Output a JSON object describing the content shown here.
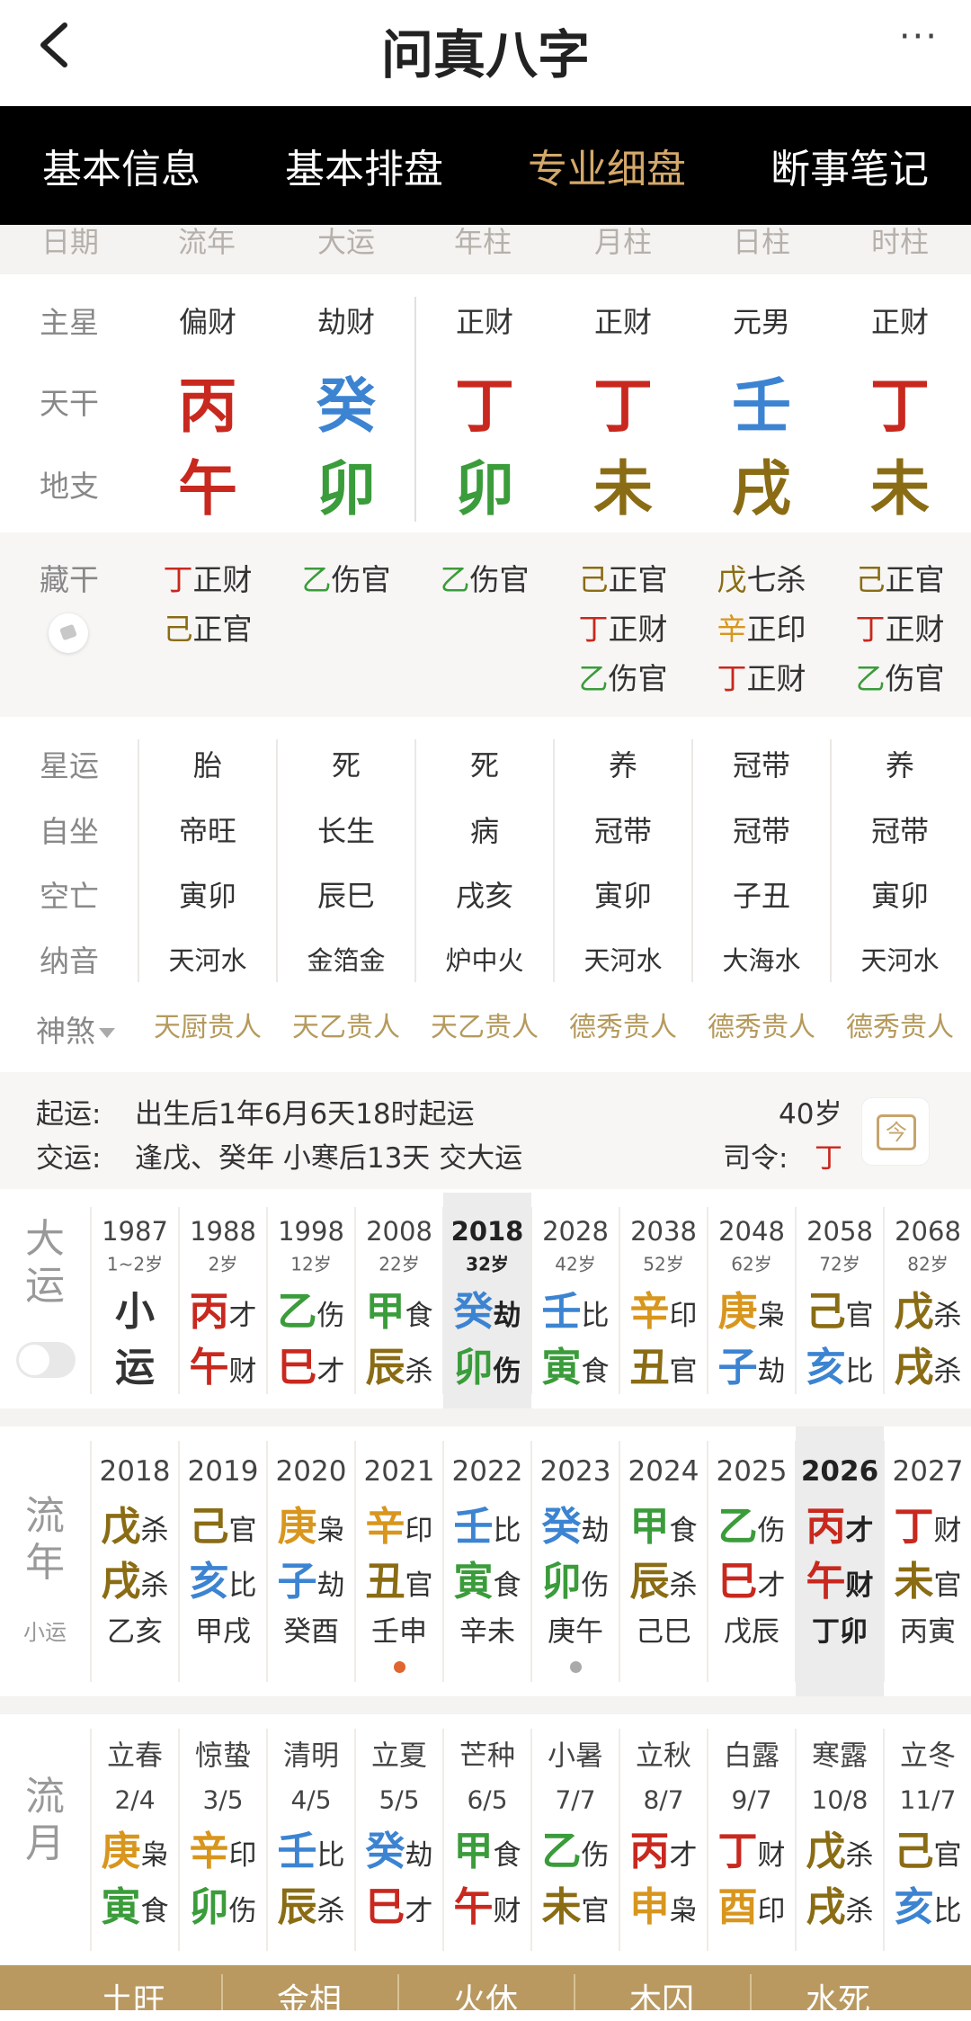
{
  "header": {
    "title": "问真八字",
    "more": "···"
  },
  "tabs": [
    {
      "label": "基本信息",
      "active": false
    },
    {
      "label": "基本排盘",
      "active": false
    },
    {
      "label": "专业细盘",
      "active": true
    },
    {
      "label": "断事笔记",
      "active": false
    }
  ],
  "colors": {
    "red": "#c8281e",
    "blue": "#3c84d2",
    "green": "#3a9c3a",
    "olive": "#8a6c14",
    "orange": "#d8961e",
    "accent": "#d4a86a"
  },
  "ghost_header": [
    "日期",
    "流年",
    "大运",
    "年柱",
    "月柱",
    "日柱",
    "时柱"
  ],
  "pillars": {
    "labels": {
      "star": "主星",
      "tiangan": "天干",
      "dizhi": "地支"
    },
    "columns": [
      {
        "star": "偏财",
        "gan": "丙",
        "gan_color": "red",
        "zhi": "午",
        "zhi_color": "red"
      },
      {
        "star": "劫财",
        "gan": "癸",
        "gan_color": "blue",
        "zhi": "卯",
        "zhi_color": "green"
      },
      {
        "star": "正财",
        "gan": "丁",
        "gan_color": "red",
        "zhi": "卯",
        "zhi_color": "green"
      },
      {
        "star": "正财",
        "gan": "丁",
        "gan_color": "red",
        "zhi": "未",
        "zhi_color": "olive"
      },
      {
        "star": "元男",
        "gan": "壬",
        "gan_color": "blue",
        "zhi": "戌",
        "zhi_color": "olive"
      },
      {
        "star": "正财",
        "gan": "丁",
        "gan_color": "red",
        "zhi": "未",
        "zhi_color": "olive"
      }
    ]
  },
  "canggan": {
    "label": "藏干",
    "columns": [
      [
        {
          "c": "丁",
          "t": "正财",
          "color": "red"
        },
        {
          "c": "己",
          "t": "正官",
          "color": "olive"
        }
      ],
      [
        {
          "c": "乙",
          "t": "伤官",
          "color": "green"
        }
      ],
      [
        {
          "c": "乙",
          "t": "伤官",
          "color": "green"
        }
      ],
      [
        {
          "c": "己",
          "t": "正官",
          "color": "olive"
        },
        {
          "c": "丁",
          "t": "正财",
          "color": "red"
        },
        {
          "c": "乙",
          "t": "伤官",
          "color": "green"
        }
      ],
      [
        {
          "c": "戊",
          "t": "七杀",
          "color": "olive"
        },
        {
          "c": "辛",
          "t": "正印",
          "color": "orange"
        },
        {
          "c": "丁",
          "t": "正财",
          "color": "red"
        }
      ],
      [
        {
          "c": "己",
          "t": "正官",
          "color": "olive"
        },
        {
          "c": "丁",
          "t": "正财",
          "color": "red"
        },
        {
          "c": "乙",
          "t": "伤官",
          "color": "green"
        }
      ]
    ]
  },
  "details": {
    "labels": {
      "xingyun": "星运",
      "zizuo": "自坐",
      "kongwang": "空亡",
      "nayin": "纳音",
      "shensha": "神煞"
    },
    "xingyun": [
      "胎",
      "死",
      "死",
      "养",
      "冠带",
      "养"
    ],
    "zizuo": [
      "帝旺",
      "长生",
      "病",
      "冠带",
      "冠带",
      "冠带"
    ],
    "kongwang": [
      "寅卯",
      "辰巳",
      "戌亥",
      "寅卯",
      "子丑",
      "寅卯"
    ],
    "nayin": [
      "天河水",
      "金箔金",
      "炉中火",
      "天河水",
      "大海水",
      "天河水"
    ],
    "shensha": [
      "天厨贵人",
      "天乙贵人",
      "天乙贵人",
      "德秀贵人",
      "德秀贵人",
      "德秀贵人"
    ]
  },
  "qiyun": {
    "line1_label": "起运:",
    "line1_value": "出生后1年6月6天18时起运",
    "line2_label": "交运:",
    "line2_value": "逢戊、癸年 小寒后13天 交大运",
    "age": "40岁",
    "siling_label": "司令:",
    "siling_value": "丁",
    "calendar_icon_text": "今"
  },
  "dayun": {
    "label": "大运",
    "columns": [
      {
        "year": "1987",
        "age": "1~2岁",
        "top": "小",
        "top_color": "black",
        "top_sub": "",
        "bot": "运",
        "bot_color": "black",
        "bot_sub": ""
      },
      {
        "year": "1988",
        "age": "2岁",
        "top": "丙",
        "top_color": "red",
        "top_sub": "才",
        "bot": "午",
        "bot_color": "red",
        "bot_sub": "财"
      },
      {
        "year": "1998",
        "age": "12岁",
        "top": "乙",
        "top_color": "green",
        "top_sub": "伤",
        "bot": "巳",
        "bot_color": "red",
        "bot_sub": "才"
      },
      {
        "year": "2008",
        "age": "22岁",
        "top": "甲",
        "top_color": "green",
        "top_sub": "食",
        "bot": "辰",
        "bot_color": "olive",
        "bot_sub": "杀"
      },
      {
        "year": "2018",
        "age": "32岁",
        "top": "癸",
        "top_color": "blue",
        "top_sub": "劫",
        "bot": "卯",
        "bot_color": "green",
        "bot_sub": "伤",
        "current": true
      },
      {
        "year": "2028",
        "age": "42岁",
        "top": "壬",
        "top_color": "blue",
        "top_sub": "比",
        "bot": "寅",
        "bot_color": "green",
        "bot_sub": "食"
      },
      {
        "year": "2038",
        "age": "52岁",
        "top": "辛",
        "top_color": "orange",
        "top_sub": "印",
        "bot": "丑",
        "bot_color": "olive",
        "bot_sub": "官"
      },
      {
        "year": "2048",
        "age": "62岁",
        "top": "庚",
        "top_color": "orange",
        "top_sub": "枭",
        "bot": "子",
        "bot_color": "blue",
        "bot_sub": "劫"
      },
      {
        "year": "2058",
        "age": "72岁",
        "top": "己",
        "top_color": "olive",
        "top_sub": "官",
        "bot": "亥",
        "bot_color": "blue",
        "bot_sub": "比"
      },
      {
        "year": "2068",
        "age": "82岁",
        "top": "戊",
        "top_color": "olive",
        "top_sub": "杀",
        "bot": "戌",
        "bot_color": "olive",
        "bot_sub": "杀"
      }
    ]
  },
  "liunian": {
    "label": "流年",
    "xiaoyun_label": "小运",
    "columns": [
      {
        "year": "2018",
        "top": "戊",
        "top_color": "olive",
        "top_sub": "杀",
        "bot": "戌",
        "bot_color": "olive",
        "bot_sub": "杀",
        "xy": "乙亥"
      },
      {
        "year": "2019",
        "top": "己",
        "top_color": "olive",
        "top_sub": "官",
        "bot": "亥",
        "bot_color": "blue",
        "bot_sub": "比",
        "xy": "甲戌"
      },
      {
        "year": "2020",
        "top": "庚",
        "top_color": "orange",
        "top_sub": "枭",
        "bot": "子",
        "bot_color": "blue",
        "bot_sub": "劫",
        "xy": "癸酉"
      },
      {
        "year": "2021",
        "top": "辛",
        "top_color": "orange",
        "top_sub": "印",
        "bot": "丑",
        "bot_color": "olive",
        "bot_sub": "官",
        "xy": "壬申",
        "dot": "orange"
      },
      {
        "year": "2022",
        "top": "壬",
        "top_color": "blue",
        "top_sub": "比",
        "bot": "寅",
        "bot_color": "green",
        "bot_sub": "食",
        "xy": "辛未"
      },
      {
        "year": "2023",
        "top": "癸",
        "top_color": "blue",
        "top_sub": "劫",
        "bot": "卯",
        "bot_color": "green",
        "bot_sub": "伤",
        "xy": "庚午",
        "dot": "gray"
      },
      {
        "year": "2024",
        "top": "甲",
        "top_color": "green",
        "top_sub": "食",
        "bot": "辰",
        "bot_color": "olive",
        "bot_sub": "杀",
        "xy": "己巳"
      },
      {
        "year": "2025",
        "top": "乙",
        "top_color": "green",
        "top_sub": "伤",
        "bot": "巳",
        "bot_color": "red",
        "bot_sub": "才",
        "xy": "戊辰"
      },
      {
        "year": "2026",
        "top": "丙",
        "top_color": "red",
        "top_sub": "才",
        "bot": "午",
        "bot_color": "red",
        "bot_sub": "财",
        "xy": "丁卯",
        "current": true
      },
      {
        "year": "2027",
        "top": "丁",
        "top_color": "red",
        "top_sub": "财",
        "bot": "未",
        "bot_color": "olive",
        "bot_sub": "官",
        "xy": "丙寅"
      }
    ]
  },
  "liuyue": {
    "label": "流月",
    "columns": [
      {
        "term": "立春",
        "date": "2/4",
        "top": "庚",
        "top_color": "orange",
        "top_sub": "枭",
        "bot": "寅",
        "bot_color": "green",
        "bot_sub": "食"
      },
      {
        "term": "惊蛰",
        "date": "3/5",
        "top": "辛",
        "top_color": "orange",
        "top_sub": "印",
        "bot": "卯",
        "bot_color": "green",
        "bot_sub": "伤"
      },
      {
        "term": "清明",
        "date": "4/5",
        "top": "壬",
        "top_color": "blue",
        "top_sub": "比",
        "bot": "辰",
        "bot_color": "olive",
        "bot_sub": "杀"
      },
      {
        "term": "立夏",
        "date": "5/5",
        "top": "癸",
        "top_color": "blue",
        "top_sub": "劫",
        "bot": "巳",
        "bot_color": "red",
        "bot_sub": "才"
      },
      {
        "term": "芒种",
        "date": "6/5",
        "top": "甲",
        "top_color": "green",
        "top_sub": "食",
        "bot": "午",
        "bot_color": "red",
        "bot_sub": "财"
      },
      {
        "term": "小暑",
        "date": "7/7",
        "top": "乙",
        "top_color": "green",
        "top_sub": "伤",
        "bot": "未",
        "bot_color": "olive",
        "bot_sub": "官"
      },
      {
        "term": "立秋",
        "date": "8/7",
        "top": "丙",
        "top_color": "red",
        "top_sub": "才",
        "bot": "申",
        "bot_color": "orange",
        "bot_sub": "枭"
      },
      {
        "term": "白露",
        "date": "9/7",
        "top": "丁",
        "top_color": "red",
        "top_sub": "财",
        "bot": "酉",
        "bot_color": "orange",
        "bot_sub": "印"
      },
      {
        "term": "寒露",
        "date": "10/8",
        "top": "戊",
        "top_color": "olive",
        "top_sub": "杀",
        "bot": "戌",
        "bot_color": "olive",
        "bot_sub": "杀"
      },
      {
        "term": "立冬",
        "date": "11/7",
        "top": "己",
        "top_color": "olive",
        "top_sub": "官",
        "bot": "亥",
        "bot_color": "blue",
        "bot_sub": "比"
      }
    ]
  },
  "bottombar": [
    "土旺",
    "金相",
    "火休",
    "木囚",
    "水死"
  ]
}
